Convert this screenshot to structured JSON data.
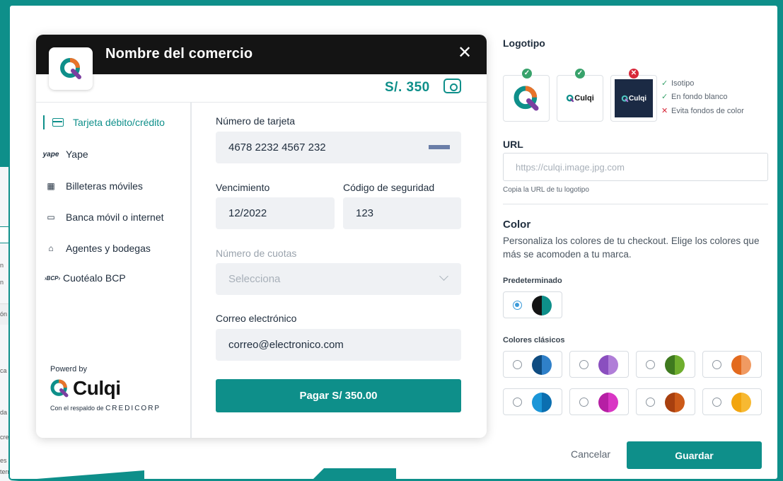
{
  "background_app": {
    "fragments": [
      "ón",
      "n",
      "n",
      "ca",
      "da",
      "credi",
      "es",
      "tern"
    ]
  },
  "checkout": {
    "merchant_name": "Nombre del comercio",
    "amount": "S/. 350",
    "methods": [
      {
        "label": "Tarjeta débito/crédito",
        "icon": "card-icon",
        "active": true
      },
      {
        "label": "Yape",
        "icon": "yape-icon",
        "active": false
      },
      {
        "label": "Billeteras móviles",
        "icon": "qr-icon",
        "active": false
      },
      {
        "label": "Banca móvil o internet",
        "icon": "monitor-icon",
        "active": false
      },
      {
        "label": "Agentes y bodegas",
        "icon": "store-icon",
        "active": false
      },
      {
        "label": "Cuotéalo BCP",
        "icon": "bcp-icon",
        "active": false
      }
    ],
    "powered_by": "Powerd by",
    "brand": "Culqi",
    "respaldo": "Con el respaldo de",
    "credicorp": "CREDICORP",
    "form": {
      "card_label": "Número de tarjeta",
      "card_value": "4678 2232 4567 232",
      "expiry_label": "Vencimiento",
      "expiry_value": "12/2022",
      "cvv_label": "Código de seguridad",
      "cvv_value": "123",
      "installments_label": "Número de cuotas",
      "installments_placeholder": "Selecciona",
      "email_label": "Correo electrónico",
      "email_value": "correo@electronico.com",
      "pay_button": "Pagar S/ 350.00"
    }
  },
  "settings": {
    "logo_title": "Logotipo",
    "logo_rules": [
      {
        "text": "Isotipo",
        "ok": true
      },
      {
        "text": "En fondo blanco",
        "ok": true
      },
      {
        "text": "Evita fondos de color",
        "ok": false
      }
    ],
    "logo_example_text": "Culqi",
    "url_title": "URL",
    "url_placeholder": "https://culqi.image.jpg.com",
    "url_hint": "Copia la URL de tu logotipo",
    "color_title": "Color",
    "color_desc": "Personaliza los colores de tu checkout. Elige los colores que más se acomoden a tu marca.",
    "default_label": "Predeterminado",
    "default_swatch": {
      "left": "#141414",
      "right": "#0e8f8a",
      "selected": true
    },
    "classic_label": "Colores clásicos",
    "classic_swatches": [
      {
        "left": "#0f4c81",
        "right": "#2f80c9"
      },
      {
        "left": "#8a4fbf",
        "right": "#b07ed8"
      },
      {
        "left": "#3f7a1f",
        "right": "#6fae2e"
      },
      {
        "left": "#e36a1e",
        "right": "#f09a62"
      },
      {
        "left": "#1b96d8",
        "right": "#0b6fb0"
      },
      {
        "left": "#b61fa4",
        "right": "#d936c4"
      },
      {
        "left": "#a8400f",
        "right": "#cc5a19"
      },
      {
        "left": "#f2a50f",
        "right": "#f7b932"
      }
    ],
    "cancel": "Cancelar",
    "save": "Guardar"
  }
}
